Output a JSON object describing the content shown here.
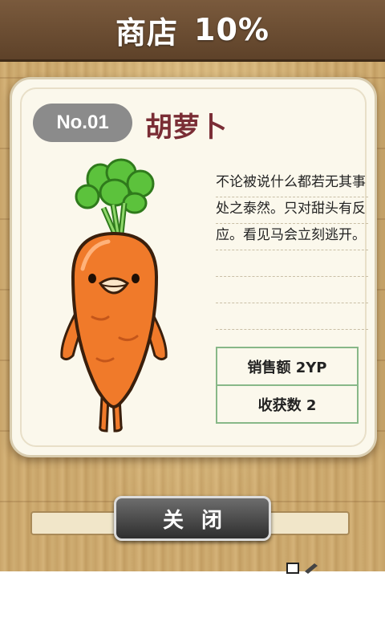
{
  "header": {
    "title": "商店",
    "percent": "10%"
  },
  "item": {
    "number": "No.01",
    "name": "胡萝卜",
    "description": "不论被说什么都若无其事处之泰然。只对甜头有反应。看见马会立刻逃开。"
  },
  "stats": {
    "sale": "销售额 2YP",
    "harvest": "收获数 2"
  },
  "close_button": {
    "label": "关闭"
  },
  "colors": {
    "header_bg": "#5e4229",
    "name_color": "#7a2d35",
    "badge_bg": "#8b8b8b",
    "stats_border": "#88b888",
    "carrot_body": "#f07a2a",
    "carrot_leaf": "#5cc23c"
  },
  "icons": {
    "carrot": "carrot-character-icon",
    "corner": "edit-icon"
  }
}
